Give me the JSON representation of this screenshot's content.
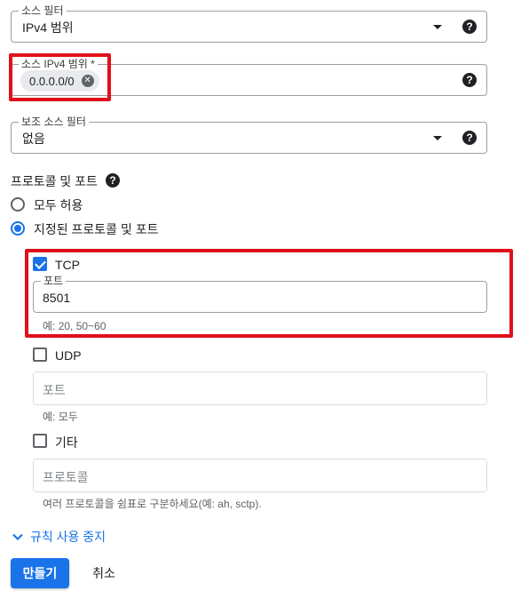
{
  "source_filter": {
    "label": "소스 필터",
    "value": "IPv4 범위"
  },
  "source_ipv4_ranges": {
    "label": "소스 IPv4 범위 *",
    "chip": "0.0.0.0/0"
  },
  "secondary_source_filter": {
    "label": "보조 소스 필터",
    "value": "없음"
  },
  "protocols_ports": {
    "heading": "프로토콜 및 포트",
    "allow_all": "모두 허용",
    "specified": "지정된 프로토콜 및 포트",
    "selected_option": "specified"
  },
  "tcp": {
    "label": "TCP",
    "checked": true,
    "ports_label": "포트",
    "ports_value": "8501",
    "hint": "예: 20, 50~60"
  },
  "udp": {
    "label": "UDP",
    "checked": false,
    "ports_placeholder": "포트",
    "hint": "예: 모두"
  },
  "other": {
    "label": "기타",
    "checked": false,
    "protocols_placeholder": "프로토콜",
    "hint": "여러 프로토콜을 쉼표로 구분하세요(예: ah, sctp)."
  },
  "disable_rule_link": "규칙 사용 중지",
  "actions": {
    "create": "만들기",
    "cancel": "취소"
  },
  "colors": {
    "accent": "#1a73e8",
    "highlight": "#e0101b"
  }
}
